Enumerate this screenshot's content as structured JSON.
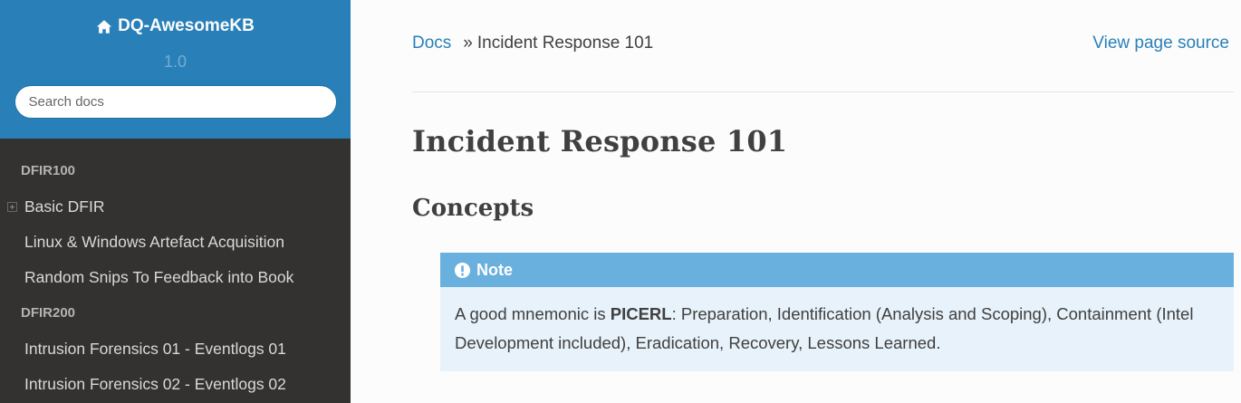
{
  "sidebar": {
    "brand": "DQ-AwesomeKB",
    "version": "1.0",
    "search_placeholder": "Search docs",
    "caption1": "DFIR100",
    "items1": [
      "Basic DFIR",
      "Linux & Windows Artefact Acquisition",
      "Random Snips To Feedback into Book"
    ],
    "caption2": "DFIR200",
    "items2": [
      "Intrusion Forensics 01 - Eventlogs 01",
      "Intrusion Forensics 02 - Eventlogs 02"
    ]
  },
  "breadcrumb": {
    "root": "Docs",
    "separator": "»",
    "current": "Incident Response 101"
  },
  "view_source": "View page source",
  "page_title": "Incident Response 101",
  "section_title": "Concepts",
  "note": {
    "title": "Note",
    "text_before": "A good mnemonic is ",
    "bold": "PICERL",
    "text_after": ": Preparation, Identification (Analysis and Scoping), Containment (Intel Development included), Eradication, Recovery, Lessons Learned."
  },
  "colors": {
    "sidebar_top": "#2980b9",
    "sidebar_bg": "#343131",
    "link": "#2980b9",
    "note_header": "#6ab0de",
    "note_bg": "#e7f2fa"
  }
}
